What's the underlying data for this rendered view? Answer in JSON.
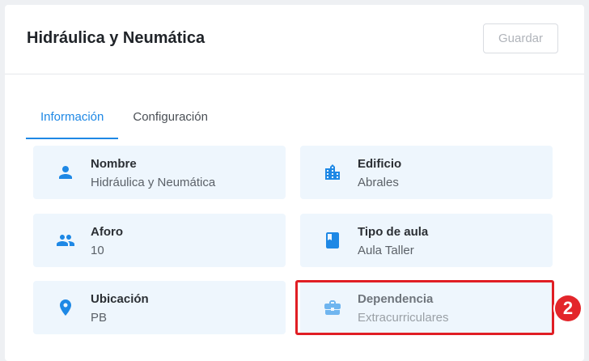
{
  "header": {
    "title": "Hidráulica y Neumática",
    "save_label": "Guardar"
  },
  "tabs": [
    {
      "label": "Información",
      "active": true
    },
    {
      "label": "Configuración",
      "active": false
    }
  ],
  "fields": [
    {
      "label": "Nombre",
      "value": "Hidráulica y Neumática",
      "icon": "person-icon"
    },
    {
      "label": "Edificio",
      "value": "Abrales",
      "icon": "building-icon"
    },
    {
      "label": "Aforo",
      "value": "10",
      "icon": "people-icon"
    },
    {
      "label": "Tipo de aula",
      "value": "Aula Taller",
      "icon": "book-icon"
    },
    {
      "label": "Ubicación",
      "value": "PB",
      "icon": "location-pin-icon"
    },
    {
      "label": "Dependencia",
      "value": "Extracurriculares",
      "icon": "briefcase-icon"
    }
  ],
  "annotation": {
    "step_number": "2",
    "color": "#e01e24"
  },
  "colors": {
    "accent": "#1e88e5",
    "tile_bg": "#eef6fd"
  }
}
